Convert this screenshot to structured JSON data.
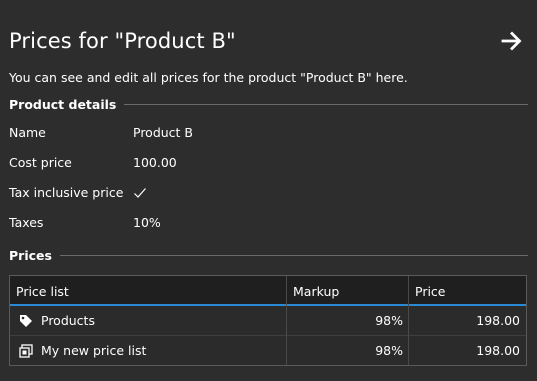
{
  "header": {
    "title": "Prices for \"Product B\"",
    "next_icon": "arrow-right-icon"
  },
  "intro": "You can see and edit all prices for the product \"Product B\" here.",
  "details": {
    "heading": "Product details",
    "rows": [
      {
        "label": "Name",
        "value": "Product B"
      },
      {
        "label": "Cost price",
        "value": "100.00"
      },
      {
        "label": "Tax inclusive price",
        "value": true,
        "icon": "checkmark-icon"
      },
      {
        "label": "Taxes",
        "value": "10%"
      }
    ]
  },
  "prices": {
    "heading": "Prices",
    "columns": [
      "Price list",
      "Markup",
      "Price"
    ],
    "rows": [
      {
        "icon": "tag-icon",
        "price_list": "Products",
        "markup": "98%",
        "price": "198.00"
      },
      {
        "icon": "price-list-icon",
        "price_list": "My new price list",
        "markup": "98%",
        "price": "198.00"
      }
    ]
  },
  "colors": {
    "background": "#2d2d2d",
    "accent": "#2b8ad4",
    "text": "#ffffff"
  }
}
